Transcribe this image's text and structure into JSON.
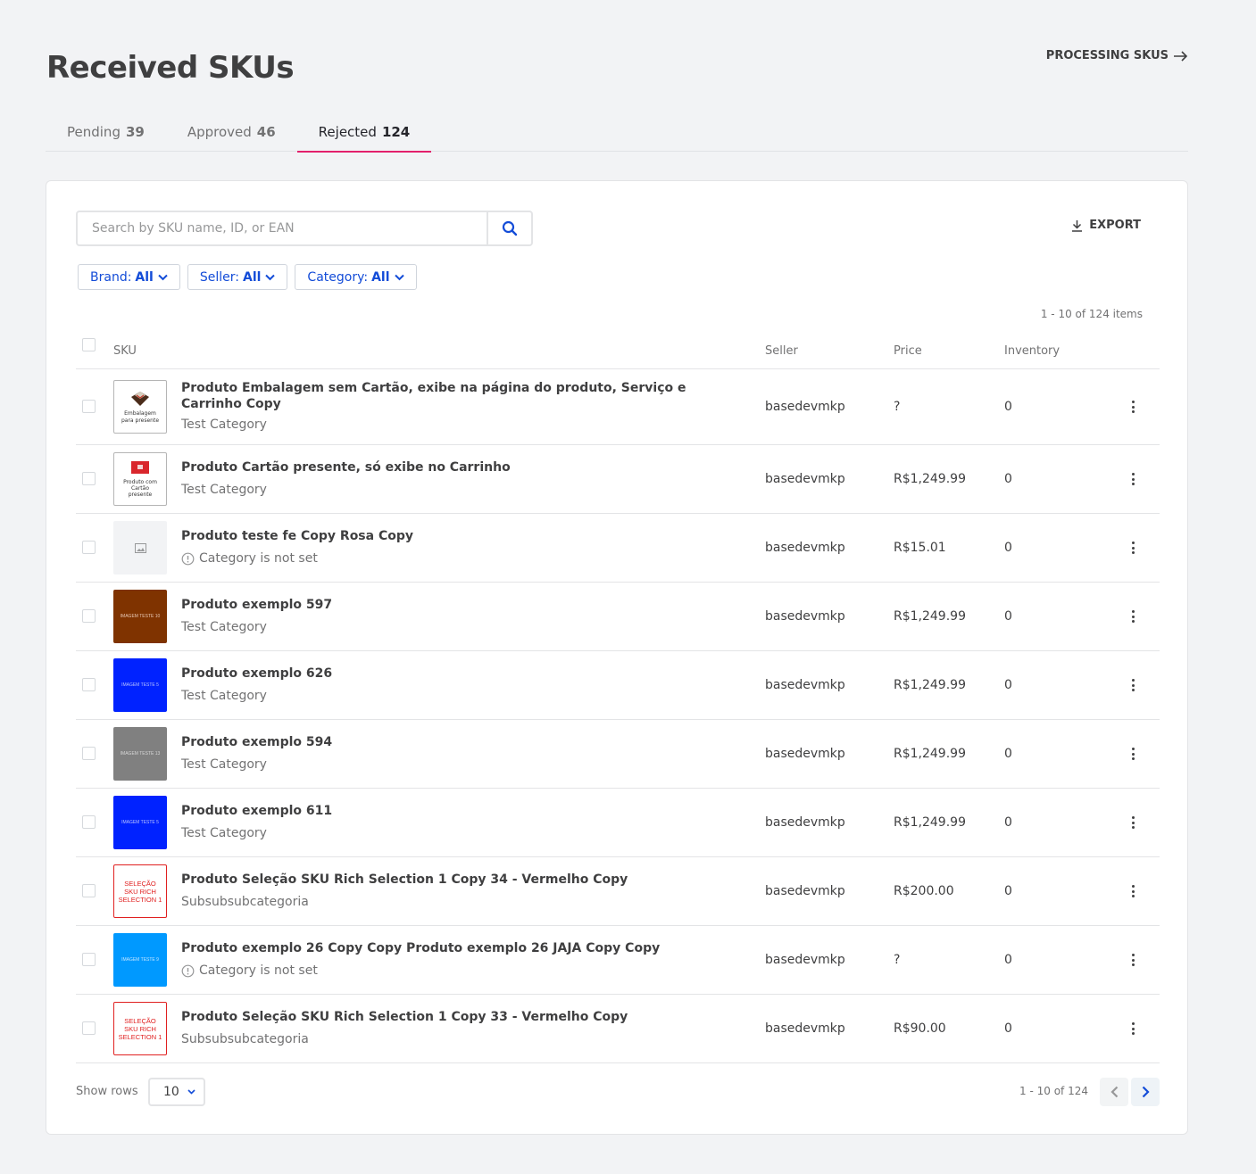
{
  "header": {
    "title": "Received SKUs",
    "processing_link": "PROCESSING SKUS"
  },
  "tabs": [
    {
      "label": "Pending",
      "count": "39"
    },
    {
      "label": "Approved",
      "count": "46"
    },
    {
      "label": "Rejected",
      "count": "124",
      "active": true
    }
  ],
  "toolbar": {
    "search_placeholder": "Search by SKU name, ID, or EAN",
    "export_label": "EXPORT"
  },
  "filters": [
    {
      "label": "Brand:",
      "value": "All"
    },
    {
      "label": "Seller:",
      "value": "All"
    },
    {
      "label": "Category:",
      "value": "All"
    }
  ],
  "items_count": "1 - 10 of 124 items",
  "table": {
    "columns": {
      "sku": "SKU",
      "seller": "Seller",
      "price": "Price",
      "inventory": "Inventory"
    },
    "rows": [
      {
        "name": "Produto Embalagem sem Cartão, exibe na página do produto, Serviço e Carrinho Copy",
        "category": "Test Category",
        "category_warning": false,
        "seller": "basedevmkp",
        "price": "?",
        "inventory": "0",
        "thumb": {
          "style": "gift",
          "text": "Embalagem para presente",
          "bg": "#ffffff",
          "fg": "#333333"
        }
      },
      {
        "name": "Produto Cartão presente, só exibe no Carrinho",
        "category": "Test Category",
        "category_warning": false,
        "seller": "basedevmkp",
        "price": "R$1,249.99",
        "inventory": "0",
        "thumb": {
          "style": "card",
          "text": "Produto com Cartão presente",
          "bg": "#ffffff",
          "fg": "#333333"
        }
      },
      {
        "name": "Produto teste fe Copy Rosa Copy",
        "category": "Category is not set",
        "category_warning": true,
        "seller": "basedevmkp",
        "price": "R$15.01",
        "inventory": "0",
        "thumb": {
          "style": "placeholder",
          "text": "",
          "bg": "#f2f3f5",
          "fg": "#979899"
        }
      },
      {
        "name": "Produto exemplo 597",
        "category": "Test Category",
        "category_warning": false,
        "seller": "basedevmkp",
        "price": "R$1,249.99",
        "inventory": "0",
        "thumb": {
          "style": "solid",
          "text": "IMAGEM TESTE 10",
          "bg": "#7f3300",
          "fg": "#e8c9b5"
        }
      },
      {
        "name": "Produto exemplo 626",
        "category": "Test Category",
        "category_warning": false,
        "seller": "basedevmkp",
        "price": "R$1,249.99",
        "inventory": "0",
        "thumb": {
          "style": "solid",
          "text": "IMAGEM TESTE 5",
          "bg": "#0022ff",
          "fg": "#b8c2ff"
        }
      },
      {
        "name": "Produto exemplo 594",
        "category": "Test Category",
        "category_warning": false,
        "seller": "basedevmkp",
        "price": "R$1,249.99",
        "inventory": "0",
        "thumb": {
          "style": "solid",
          "text": "IMAGEM TESTE 13",
          "bg": "#808080",
          "fg": "#d6d6d6"
        }
      },
      {
        "name": "Produto exemplo 611",
        "category": "Test Category",
        "category_warning": false,
        "seller": "basedevmkp",
        "price": "R$1,249.99",
        "inventory": "0",
        "thumb": {
          "style": "solid",
          "text": "IMAGEM TESTE 5",
          "bg": "#0022ff",
          "fg": "#b8c2ff"
        }
      },
      {
        "name": "Produto Seleção SKU Rich Selection 1 Copy 34 - Vermelho Copy",
        "category": "Subsubsubcategoria",
        "category_warning": false,
        "seller": "basedevmkp",
        "price": "R$200.00",
        "inventory": "0",
        "thumb": {
          "style": "outlined",
          "text": "SELEÇÃO SKU RICH SELECTION 1",
          "bg": "#ffffff",
          "fg": "#e02020"
        }
      },
      {
        "name": "Produto exemplo 26 Copy Copy Produto exemplo 26 JAJA Copy Copy",
        "category": "Category is not set",
        "category_warning": true,
        "seller": "basedevmkp",
        "price": "?",
        "inventory": "0",
        "thumb": {
          "style": "solid",
          "text": "IMAGEM TESTE 9",
          "bg": "#0099ff",
          "fg": "#c6e6ff"
        }
      },
      {
        "name": "Produto Seleção SKU Rich Selection 1 Copy 33 - Vermelho Copy",
        "category": "Subsubsubcategoria",
        "category_warning": false,
        "seller": "basedevmkp",
        "price": "R$90.00",
        "inventory": "0",
        "thumb": {
          "style": "outlined",
          "text": "SELEÇÃO SKU RICH SELECTION 1",
          "bg": "#ffffff",
          "fg": "#e02020"
        }
      }
    ]
  },
  "pagination": {
    "show_rows_label": "Show rows",
    "rows_per_page": "10",
    "range": "1 - 10 of 124"
  },
  "colors": {
    "accent_tab": "#e3206b",
    "link_blue": "#134cd8",
    "background": "#f2f3f5"
  }
}
